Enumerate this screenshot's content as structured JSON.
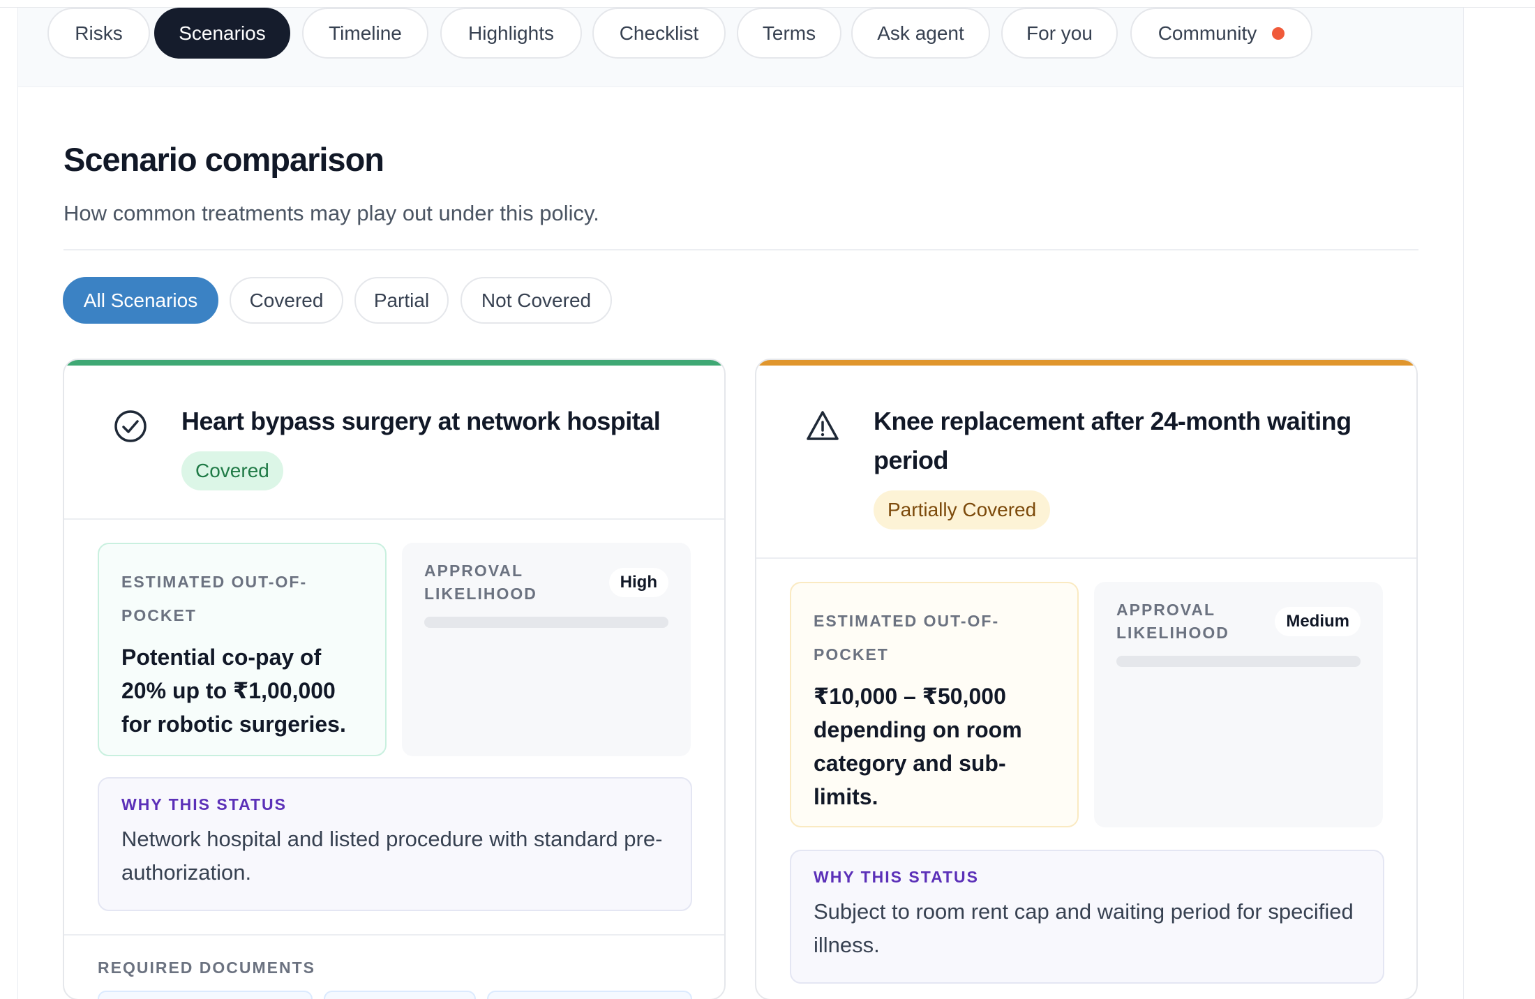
{
  "tabs": [
    {
      "label": "Risks",
      "active": false
    },
    {
      "label": "Scenarios",
      "active": true
    },
    {
      "label": "Timeline",
      "active": false
    },
    {
      "label": "Highlights",
      "active": false
    },
    {
      "label": "Checklist",
      "active": false
    },
    {
      "label": "Terms",
      "active": false
    },
    {
      "label": "Ask agent",
      "active": false
    },
    {
      "label": "For you",
      "active": false
    },
    {
      "label": "Community",
      "active": false,
      "notification_dot": true
    }
  ],
  "page": {
    "title": "Scenario comparison",
    "subtitle": "How common treatments may play out under this policy."
  },
  "filters": [
    {
      "label": "All Scenarios",
      "active": true
    },
    {
      "label": "Covered",
      "active": false
    },
    {
      "label": "Partial",
      "active": false
    },
    {
      "label": "Not Covered",
      "active": false
    }
  ],
  "scenarios": [
    {
      "icon": "check-circle-icon",
      "title": "Heart bypass surgery at network hospital",
      "status": "Covered",
      "status_color": "#1f7a46",
      "accent_color": "#3fa874",
      "oop_label": "ESTIMATED OUT-OF-POCKET",
      "oop_value": "Potential co-pay of 20% up to ₹1,00,000 for robotic surgeries.",
      "approval_label": "APPROVAL LIKELIHOOD",
      "approval_level": "High",
      "why_label": "WHY THIS STATUS",
      "why_text": "Network hospital and listed procedure with standard pre-authorization.",
      "docs_label": "REQUIRED DOCUMENTS"
    },
    {
      "icon": "warning-triangle-icon",
      "title": "Knee replacement after 24-month waiting period",
      "status": "Partially Covered",
      "status_color": "#7c4a0b",
      "accent_color": "#e0962d",
      "oop_label": "ESTIMATED OUT-OF-POCKET",
      "oop_value": "₹10,000 – ₹50,000 depending on room category and sub-limits.",
      "approval_label": "APPROVAL LIKELIHOOD",
      "approval_level": "Medium",
      "why_label": "WHY THIS STATUS",
      "why_text": "Subject to room rent cap and waiting period for specified illness."
    }
  ]
}
